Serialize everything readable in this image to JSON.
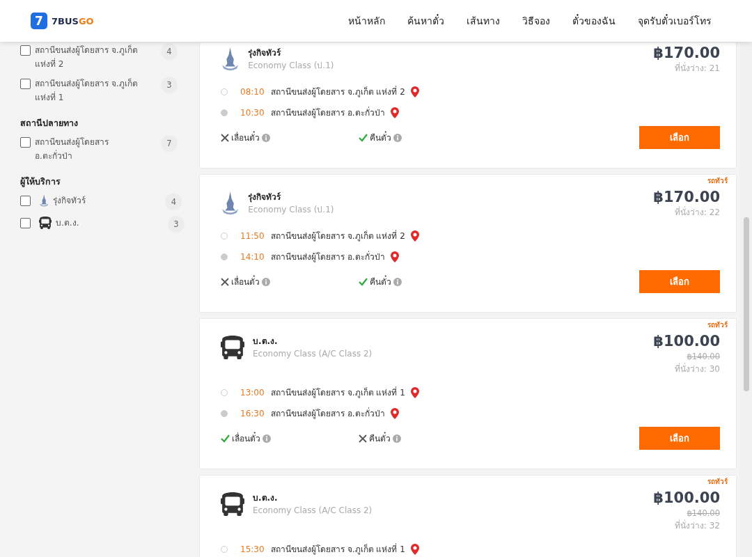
{
  "header": {
    "logo": {
      "number": "7",
      "word_a": "7BUS",
      "word_b": "GO"
    },
    "nav": [
      "หน้าหลัก",
      "ค้นหาตั๋ว",
      "เส้นทาง",
      "วิธีจอง",
      "ตั๋วของฉัน",
      "จุดรับตั๋วเบอร์โทร"
    ]
  },
  "sidebar": {
    "groups": [
      {
        "items": [
          {
            "label": "สถานีขนส่งผู้โดยสาร จ.ภูเก็ต แห่งที่ 2",
            "count": "4",
            "checked": false
          },
          {
            "label": "สถานีขนส่งผู้โดยสาร จ.ภูเก็ต แห่งที่ 1",
            "count": "3",
            "checked": false
          }
        ]
      },
      {
        "title": "สถานีปลายทาง",
        "items": [
          {
            "label": "สถานีขนส่งผู้โดยสาร อ.ตะกั่วป่า",
            "count": "7",
            "checked": false
          }
        ]
      },
      {
        "title": "ผู้ให้บริการ",
        "items": [
          {
            "label": "รุ่งกิจทัวร์",
            "count": "4",
            "checked": false,
            "kind": "temple"
          },
          {
            "label": "บ.ต.ง.",
            "count": "3",
            "checked": false,
            "kind": "bus"
          }
        ]
      }
    ]
  },
  "trips": [
    {
      "kind": "temple",
      "operator": "รุ่งกิจทัวร์",
      "class": "Economy Class (ป.1)",
      "price": "฿170.00",
      "seats": "ที่นั่งว่าง: 21",
      "stops": [
        {
          "time": "08:10",
          "place": "สถานีขนส่งผู้โดยสาร จ.ภูเก็ต แห่งที่ 2"
        },
        {
          "time": "10:30",
          "place": "สถานีขนส่งผู้โดยสาร อ.ตะกั่วป่า"
        }
      ],
      "features": [
        {
          "label": "เลื่อนตั๋ว",
          "available": false
        },
        {
          "label": "คืนตั๋ว",
          "available": true
        }
      ],
      "button": "เลือก"
    },
    {
      "tag": "รถทัวร์",
      "kind": "temple",
      "operator": "รุ่งกิจทัวร์",
      "class": "Economy Class (ป.1)",
      "price": "฿170.00",
      "seats": "ที่นั่งว่าง: 22",
      "stops": [
        {
          "time": "11:50",
          "place": "สถานีขนส่งผู้โดยสาร จ.ภูเก็ต แห่งที่ 2"
        },
        {
          "time": "14:10",
          "place": "สถานีขนส่งผู้โดยสาร อ.ตะกั่วป่า"
        }
      ],
      "features": [
        {
          "label": "เลื่อนตั๋ว",
          "available": false
        },
        {
          "label": "คืนตั๋ว",
          "available": true
        }
      ],
      "button": "เลือก"
    },
    {
      "tag": "รถทัวร์",
      "kind": "bus",
      "operator": "บ.ต.ง.",
      "class": "Economy Class (A/C Class 2)",
      "price": "฿100.00",
      "old_price": "฿140.00",
      "seats": "ที่นั่งว่าง: 30",
      "stops": [
        {
          "time": "13:00",
          "place": "สถานีขนส่งผู้โดยสาร จ.ภูเก็ต แห่งที่ 1"
        },
        {
          "time": "16:30",
          "place": "สถานีขนส่งผู้โดยสาร อ.ตะกั่วป่า"
        }
      ],
      "features": [
        {
          "label": "เลื่อนตั๋ว",
          "available": true
        },
        {
          "label": "คืนตั๋ว",
          "available": false
        }
      ],
      "button": "เลือก"
    },
    {
      "tag": "รถทัวร์",
      "kind": "bus",
      "operator": "บ.ต.ง.",
      "class": "Economy Class (A/C Class 2)",
      "price": "฿100.00",
      "old_price": "฿140.00",
      "seats": "ที่นั่งว่าง: 32",
      "stops": [
        {
          "time": "15:30",
          "place": "สถานีขนส่งผู้โดยสาร จ.ภูเก็ต แห่งที่ 1"
        }
      ]
    }
  ]
}
